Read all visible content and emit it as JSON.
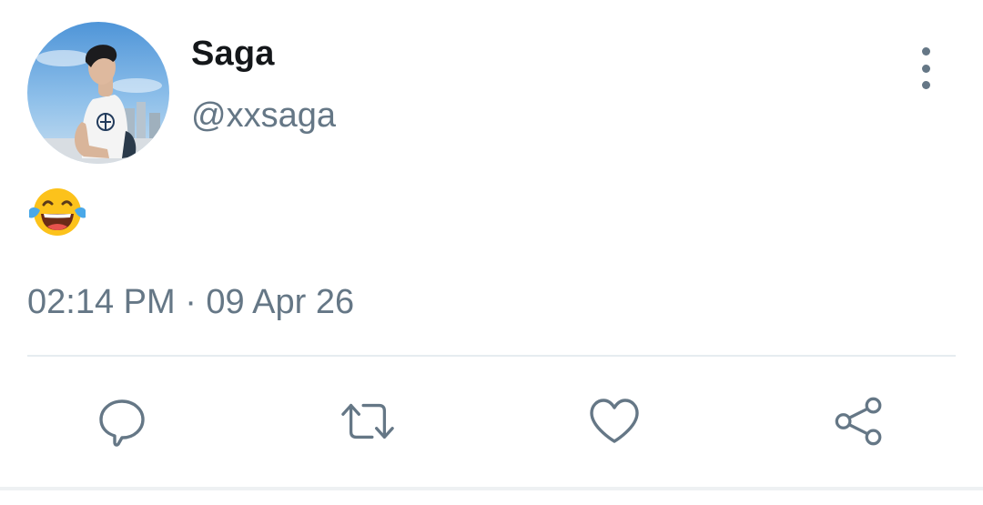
{
  "user": {
    "display_name": "Saga",
    "handle": "@xxsaga"
  },
  "tweet": {
    "emoji_icon": "face-with-tears-of-joy-icon",
    "timestamp": "02:14 PM · 09 Apr 26"
  },
  "actions": {
    "reply_icon": "speech-bubble-icon",
    "retweet_icon": "retweet-icon",
    "like_icon": "heart-icon",
    "share_icon": "share-icon"
  },
  "colors": {
    "name": "#14171a",
    "secondary": "#657786",
    "divider": "#e6ecf0",
    "background": "#ffffff"
  }
}
